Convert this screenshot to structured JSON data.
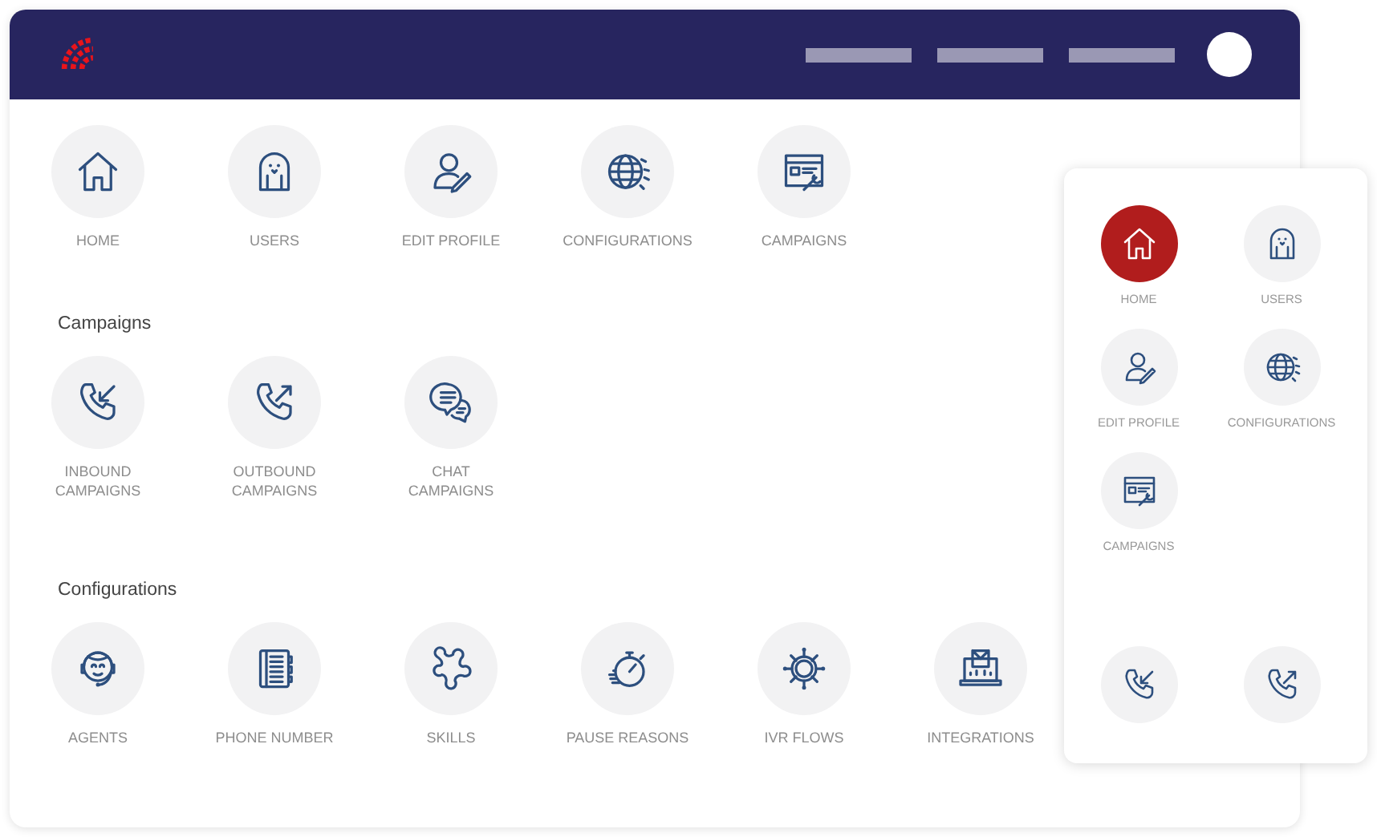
{
  "top_items": [
    {
      "label": "HOME"
    },
    {
      "label": "USERS"
    },
    {
      "label": "EDIT PROFILE"
    },
    {
      "label": "CONFIGURATIONS"
    },
    {
      "label": "CAMPAIGNS"
    }
  ],
  "sections": [
    {
      "title": "Campaigns",
      "items": [
        {
          "label": "INBOUND\nCAMPAIGNS"
        },
        {
          "label": "OUTBOUND\nCAMPAIGNS"
        },
        {
          "label": "CHAT\nCAMPAIGNS"
        }
      ]
    },
    {
      "title": "Configurations",
      "items": [
        {
          "label": "AGENTS"
        },
        {
          "label": "PHONE NUMBER"
        },
        {
          "label": "SKILLS"
        },
        {
          "label": "PAUSE REASONS"
        },
        {
          "label": "IVR FLOWS"
        },
        {
          "label": "INTEGRATIONS"
        }
      ]
    }
  ],
  "panel": {
    "items": [
      {
        "label": "HOME",
        "selected": true
      },
      {
        "label": "USERS",
        "selected": false
      },
      {
        "label": "EDIT PROFILE",
        "selected": false
      },
      {
        "label": "CONFIGURATIONS",
        "selected": false
      },
      {
        "label": "CAMPAIGNS",
        "selected": false
      }
    ],
    "lower_items": [
      {
        "selected": false
      },
      {
        "selected": false
      }
    ]
  }
}
